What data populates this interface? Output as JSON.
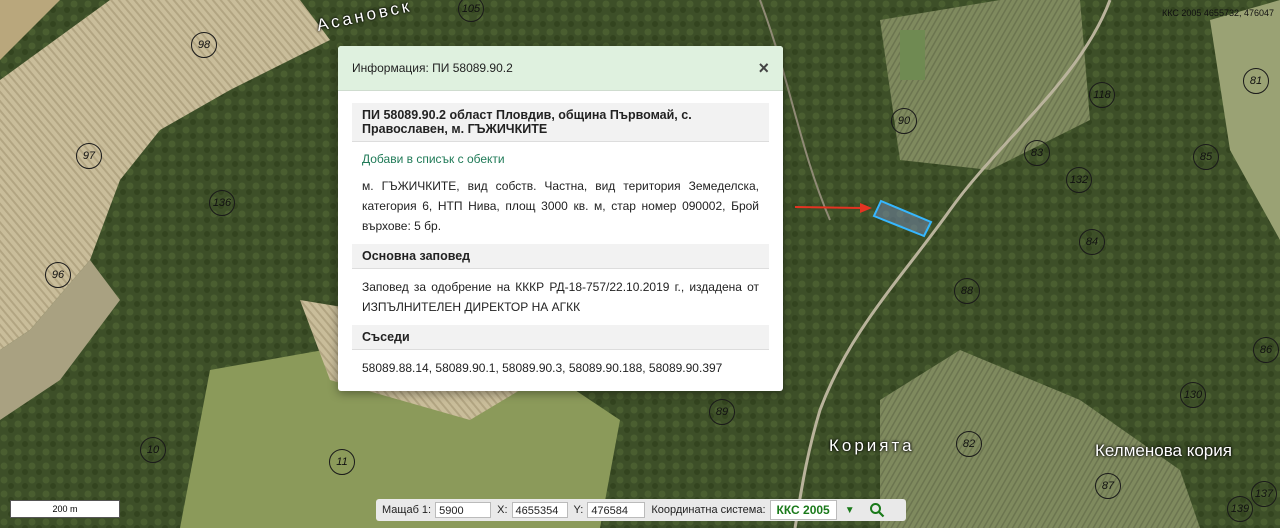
{
  "map": {
    "parcel_labels": [
      "98",
      "105",
      "97",
      "136",
      "96",
      "10",
      "11",
      "90",
      "118",
      "81",
      "83",
      "85",
      "132",
      "84",
      "88",
      "89",
      "82",
      "87",
      "130",
      "86",
      "137",
      "139"
    ],
    "places": [
      "Асановск",
      "Корията",
      "Келменова кория"
    ],
    "coord_readout": "ККС 2005 4655732, 476047"
  },
  "dialog": {
    "title": "Информация: ПИ 58089.90.2",
    "close_icon": "×",
    "parcel_heading": "ПИ 58089.90.2 област Пловдив, община Първомай, с. Православен, м. ГЪЖИЧКИТЕ",
    "add_link": "Добави в списък с обекти",
    "details": "м. ГЪЖИЧКИТЕ, вид собств. Частна, вид територия Земеделска, категория 6, НТП Нива, площ 3000 кв. м, стар номер 090002, Брой върхове: 5 бр.",
    "order_heading": "Основна заповед",
    "order_text": "Заповед за одобрение на КККР РД-18-757/22.10.2019 г., издадена от ИЗПЪЛНИТЕЛЕН ДИРЕКТОР НА АГКК",
    "neighbors_heading": "Съседи",
    "neighbors_text": "58089.88.14, 58089.90.1, 58089.90.3, 58089.90.188, 58089.90.397"
  },
  "scale_bar": {
    "label": "200 m"
  },
  "toolbar": {
    "scale_label": "Мащаб 1:",
    "scale_value": "5900",
    "x_label": "X:",
    "x_value": "4655354",
    "y_label": "Y:",
    "y_value": "476584",
    "crs_label": "Координатна система:",
    "crs_value": "ККС 2005"
  },
  "colors": {
    "highlight": "#36b7ff",
    "arrow": "#e53322",
    "accent": "#1a7a1a"
  }
}
